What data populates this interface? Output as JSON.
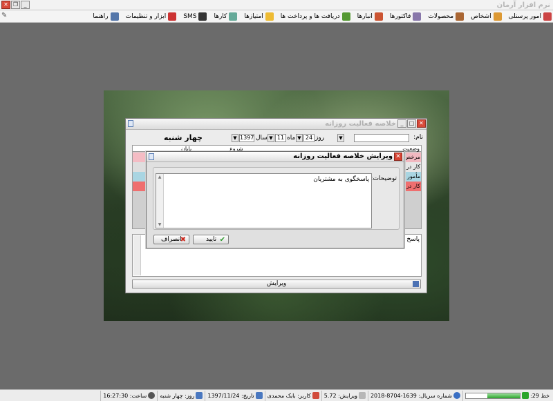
{
  "app": {
    "title": "نرم افزار آرمان"
  },
  "menu": [
    {
      "label": "امور پرسنلی",
      "icon": "personnel-icon",
      "color": "#c44"
    },
    {
      "label": "اشخاص",
      "icon": "people-icon",
      "color": "#d93"
    },
    {
      "label": "محصولات",
      "icon": "products-icon",
      "color": "#a63"
    },
    {
      "label": "فاکتورها",
      "icon": "invoices-icon",
      "color": "#87a"
    },
    {
      "label": "انبارها",
      "icon": "warehouse-icon",
      "color": "#c53"
    },
    {
      "label": "دریافت ها و پرداخت ها",
      "icon": "payments-icon",
      "color": "#593"
    },
    {
      "label": "امتیازها",
      "icon": "star-icon",
      "color": "#eb3"
    },
    {
      "label": "کارها",
      "icon": "tasks-icon",
      "color": "#6a9"
    },
    {
      "label": "SMS",
      "icon": "sms-icon",
      "color": "#333"
    },
    {
      "label": "ابزار و تنظیمات",
      "icon": "tools-icon",
      "color": "#c33"
    },
    {
      "label": "راهنما",
      "icon": "help-icon",
      "color": "#57a"
    }
  ],
  "window": {
    "title": "خلاصه فعالیت روزانه",
    "name_label": "نام:",
    "day_label": "روز",
    "day_value": "24",
    "month_label": "ماه",
    "month_value": "11",
    "year_label": "سال",
    "year_value": "1397",
    "weekday": "چهار شنبه",
    "grid": {
      "headers": {
        "status": "وضعیت",
        "start": "شروع",
        "end": "پایان"
      },
      "status_cells": [
        {
          "text": "مرخص",
          "color": "#f2b8c0"
        },
        {
          "text": "کار در",
          "color": "#e6e6e6"
        },
        {
          "text": "مأمور",
          "color": "#a9d5e2"
        },
        {
          "text": "کار در",
          "color": "#ef6f6f"
        }
      ],
      "left_colors": [
        "#f4bcc4",
        "#dedede",
        "#a9d5e2",
        "#ef6f6f"
      ]
    },
    "memo_label": "پاسخ",
    "edit_button": "ویرایش"
  },
  "dialog": {
    "title": "ویرایش خلاصه فعالیت روزانه",
    "desc_label": "توضیحات:",
    "desc_value": "پاسخگوی به مشتریان",
    "ok_button": "تایید",
    "cancel_button": "انصراف"
  },
  "statusbar": {
    "line": "خط 29:",
    "progress": 0.6,
    "serial": "شماره سریال: 1639-8704-2018",
    "version": "ویرایش: 5.72",
    "user": "کاربر: بابک محمدی",
    "date": "تاریخ: 1397/11/24",
    "day": "روز: چهار شنبه",
    "time": "ساعت: 16:27:30"
  }
}
